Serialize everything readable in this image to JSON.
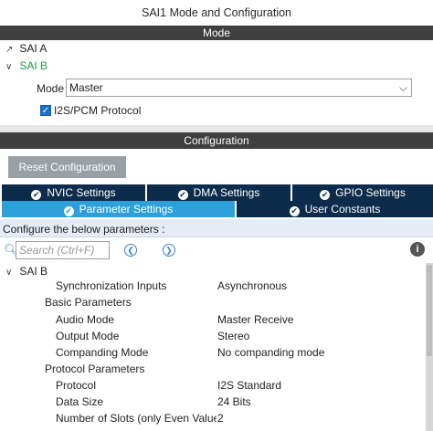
{
  "window": {
    "title": "SAI1 Mode and Configuration"
  },
  "mode_bar": {
    "label": "Mode"
  },
  "mode_tree": {
    "sai_a": {
      "label": "SAI A"
    },
    "sai_b": {
      "label": "SAI B"
    },
    "mode_field": {
      "label": "Mode",
      "value": "Master"
    },
    "i2s_protocol": {
      "label": "I2S/PCM Protocol",
      "checked": true
    }
  },
  "config_bar": {
    "label": "Configuration"
  },
  "reset_button": {
    "label": "Reset Configuration"
  },
  "tabs": [
    {
      "label": "NVIC Settings",
      "active": false
    },
    {
      "label": "DMA Settings",
      "active": false
    },
    {
      "label": "GPIO Settings",
      "active": false
    },
    {
      "label": "Parameter Settings",
      "active": true
    },
    {
      "label": "User Constants",
      "active": false
    }
  ],
  "params_header": "Configure the below parameters :",
  "search": {
    "placeholder": "Search (Ctrl+F)"
  },
  "params_tree": {
    "root": "SAI B",
    "sync_inputs": {
      "label": "Synchronization Inputs",
      "value": "Asynchronous"
    },
    "basic_group": "Basic Parameters",
    "audio_mode": {
      "label": "Audio Mode",
      "value": "Master Receive"
    },
    "output_mode": {
      "label": "Output Mode",
      "value": "Stereo"
    },
    "companding": {
      "label": "Companding Mode",
      "value": "No companding mode"
    },
    "protocol_group": "Protocol Parameters",
    "protocol": {
      "label": "Protocol",
      "value": "I2S Standard"
    },
    "data_size": {
      "label": "Data Size",
      "value": "24 Bits"
    },
    "num_slots": {
      "label": "Number of Slots (only Even Values...",
      "value": "2"
    }
  },
  "colors": {
    "accent": "#2d9fd9",
    "tab_dark": "#0d2b4a",
    "bar": "#3f3f3f",
    "green": "#1a9a4a"
  }
}
